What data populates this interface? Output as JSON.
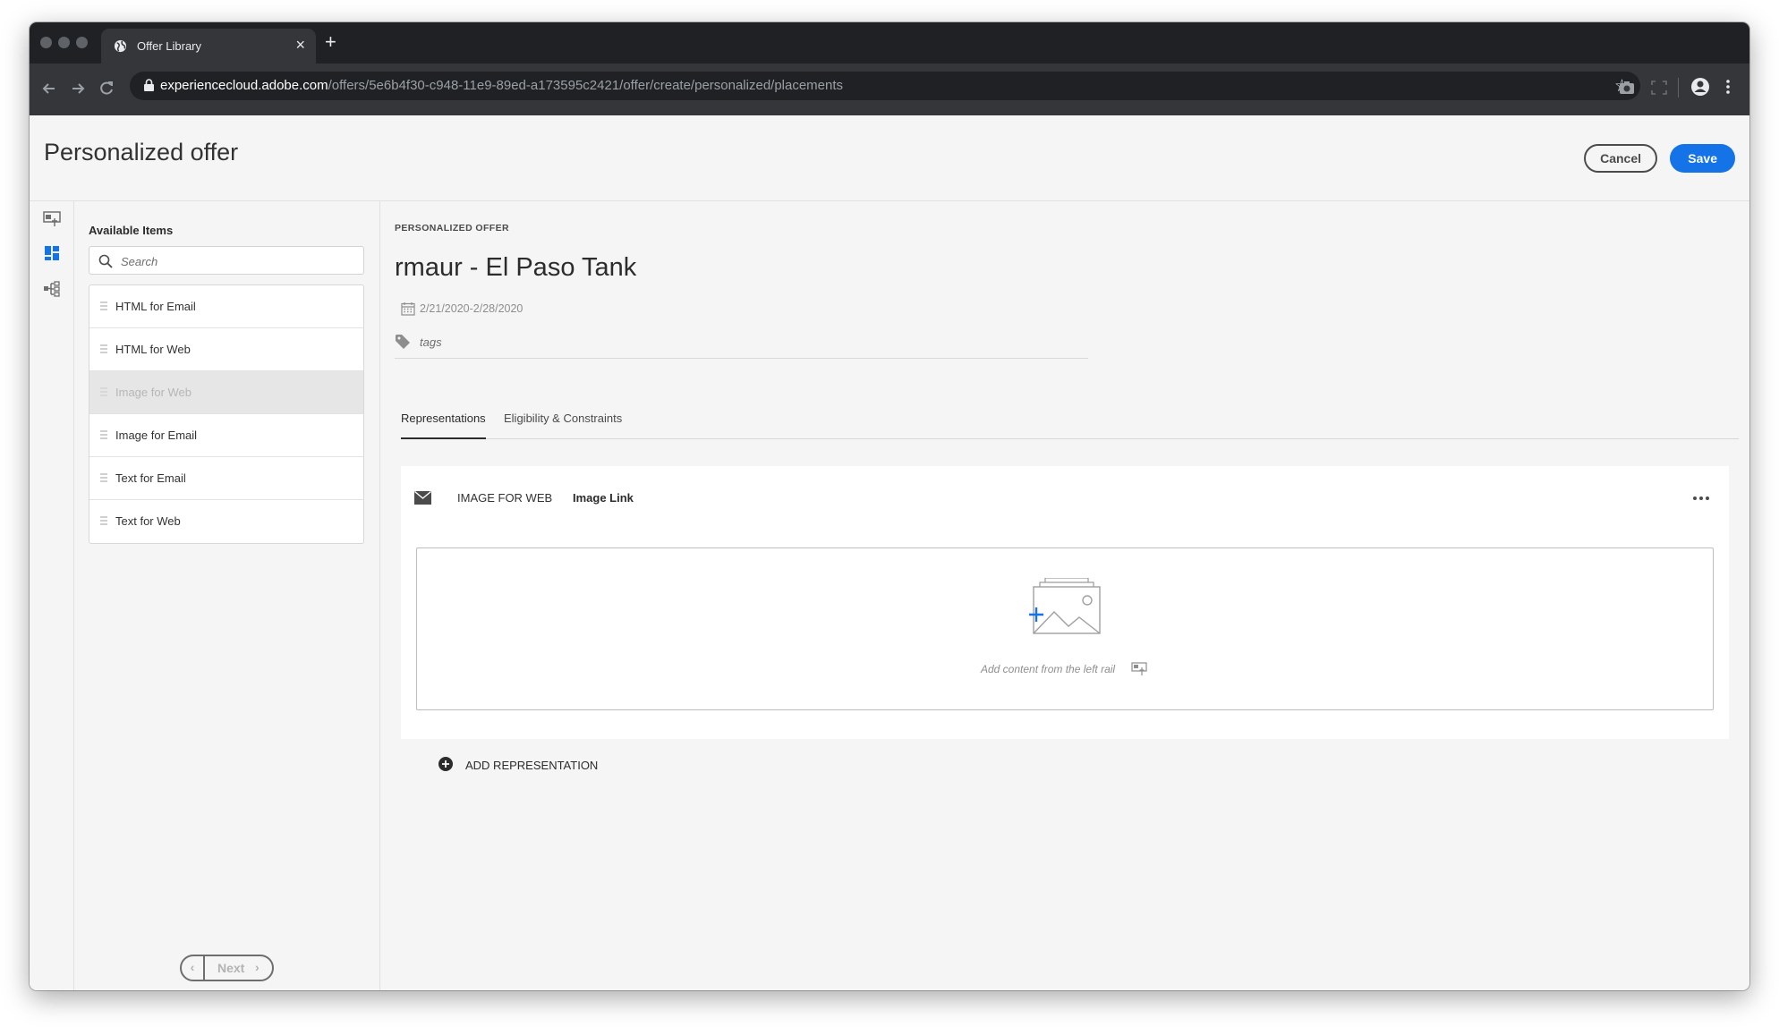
{
  "browser": {
    "tab_title": "Offer Library",
    "new_tab_glyph": "+",
    "url_host": "experiencecloud.adobe.com",
    "url_path": "/offers/5e6b4f30-c948-11e9-89ed-a173595c2421/offer/create/personalized/placements"
  },
  "header": {
    "title": "Personalized offer",
    "cancel_label": "Cancel",
    "save_label": "Save"
  },
  "rail": {
    "icons": [
      "placements-icon",
      "components-icon",
      "hierarchy-icon"
    ],
    "active_color": "#1473e6"
  },
  "items_panel": {
    "title": "Available Items",
    "search_placeholder": "Search",
    "items": [
      {
        "label": "HTML for Email",
        "disabled": false
      },
      {
        "label": "HTML for Web",
        "disabled": false
      },
      {
        "label": "Image for Web",
        "disabled": true
      },
      {
        "label": "Image for Email",
        "disabled": false
      },
      {
        "label": "Text for Email",
        "disabled": false
      },
      {
        "label": "Text for Web",
        "disabled": false
      }
    ],
    "next_label": "Next"
  },
  "offer": {
    "eyebrow": "PERSONALIZED OFFER",
    "name": "rmaur - El Paso Tank",
    "date_range": "2/21/2020-2/28/2020",
    "tags_placeholder": "tags"
  },
  "tabs": [
    {
      "label": "Representations",
      "active": true
    },
    {
      "label": "Eligibility & Constraints",
      "active": false
    }
  ],
  "representation": {
    "channel": "IMAGE FOR WEB",
    "content_type": "Image Link",
    "dropzone_hint": "Add content from the left rail"
  },
  "add_representation_label": "ADD REPRESENTATION",
  "colors": {
    "accent": "#1473e6",
    "chrome_dark": "#202124",
    "chrome_toolbar": "#35363a"
  }
}
